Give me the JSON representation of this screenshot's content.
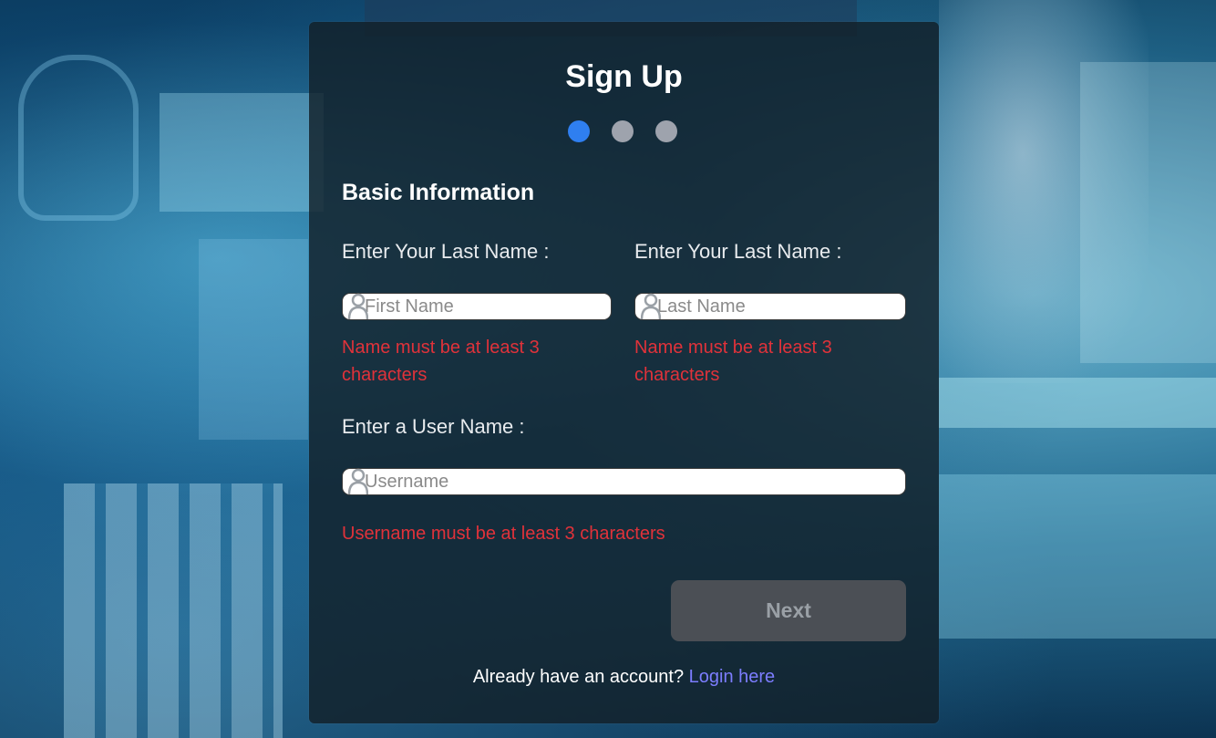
{
  "form": {
    "title": "Sign Up",
    "steps": [
      {
        "state": "active"
      },
      {
        "state": "inactive"
      },
      {
        "state": "inactive"
      }
    ],
    "section_title": "Basic Information",
    "first_name": {
      "label": "Enter Your Last Name :",
      "placeholder": "First Name",
      "value": "",
      "error": "Name must be at least 3 characters"
    },
    "last_name": {
      "label": "Enter Your Last Name :",
      "placeholder": "Last Name",
      "value": "",
      "error": "Name must be at least 3 characters"
    },
    "username": {
      "label": "Enter a User Name :",
      "placeholder": "Username",
      "value": "",
      "error": "Username must be at least 3 characters"
    },
    "next_label": "Next",
    "footer_text": "Already have an account?",
    "login_link": "Login here"
  },
  "colors": {
    "active_step": "#2f7ff0",
    "inactive_step": "#9ea3ad",
    "error": "#e0323a",
    "link": "#7c7dff",
    "button_disabled": "#4b4f55"
  },
  "icons": {
    "input_icon": "user-icon"
  }
}
